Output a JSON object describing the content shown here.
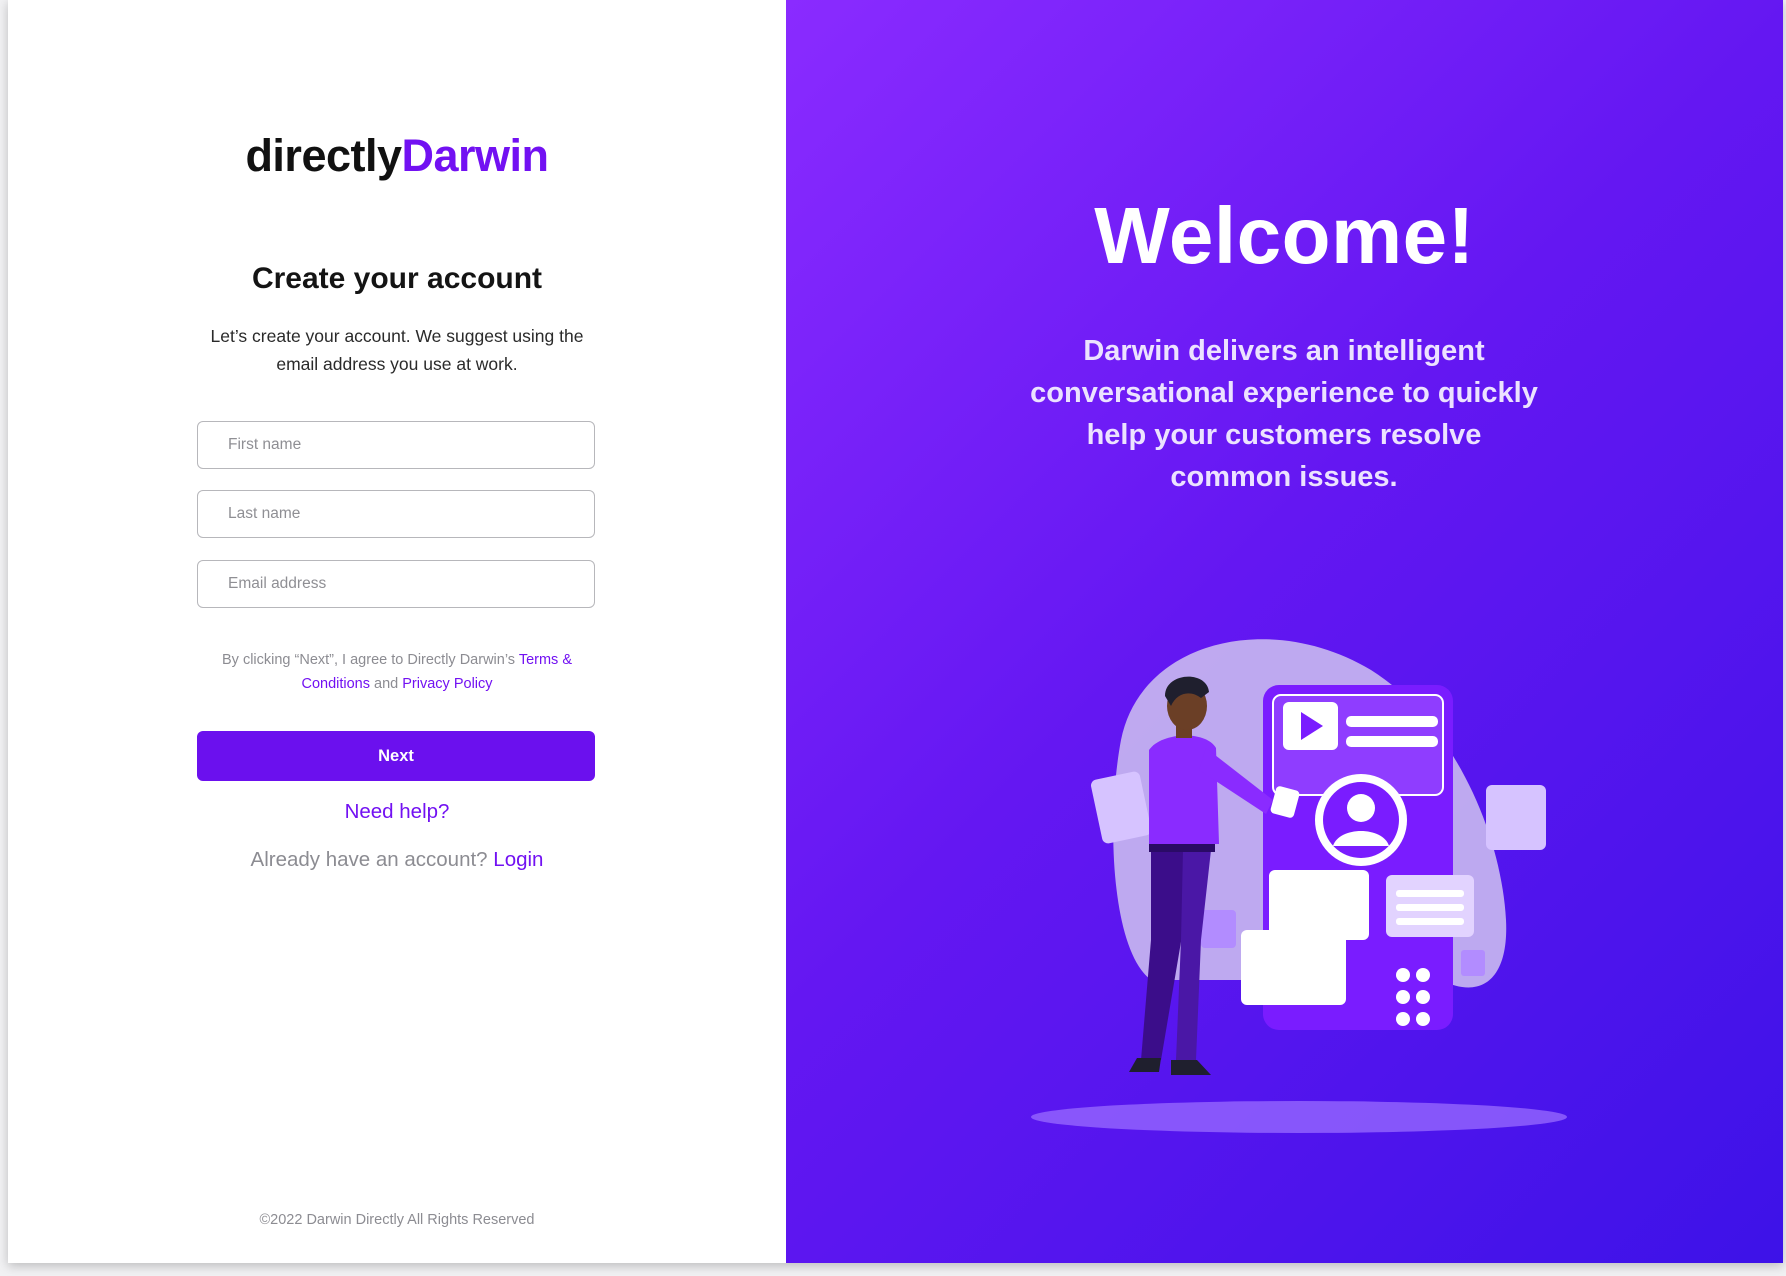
{
  "brand": {
    "part1": "directly",
    "part2": "Darwin",
    "accent_color": "#7211f2"
  },
  "form": {
    "title": "Create your account",
    "subtitle": "Let’s create your account. We suggest using the email address you use at work.",
    "fields": {
      "first_name_placeholder": "First name",
      "last_name_placeholder": "Last name",
      "email_placeholder": "Email address"
    },
    "terms": {
      "prefix": "By clicking “Next”, I agree to Directly Darwin’s",
      "terms_link": "Terms & Conditions",
      "conjunction": "and",
      "privacy_link": "Privacy Policy"
    },
    "next_label": "Next",
    "help_label": "Need help?",
    "login_prompt": "Already have an account?",
    "login_label": "Login"
  },
  "footer": {
    "copyright": "©2022 Darwin Directly All Rights Reserved"
  },
  "hero": {
    "welcome": "Welcome!",
    "tagline": "Darwin delivers an intelligent conversational experience to quickly help your customers resolve common issues.",
    "gradient_start": "#8a2bff",
    "gradient_end": "#3d12e8",
    "illustration": "person-with-phone-illustration"
  }
}
